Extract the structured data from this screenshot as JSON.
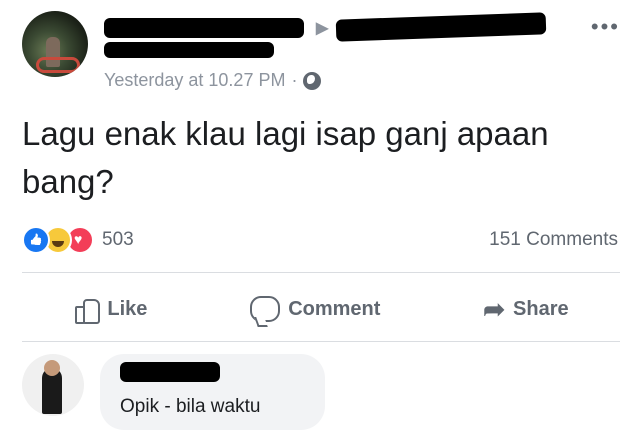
{
  "post": {
    "author_redacted": "",
    "timestamp": "Yesterday at 10.27 PM",
    "separator": "·",
    "privacy_icon": "globe-icon",
    "more_icon": "more-options-icon",
    "text": "Lagu enak klau lagi isap ganj apaan bang?"
  },
  "stats": {
    "reaction_icons": [
      "like-reaction-icon",
      "haha-reaction-icon",
      "love-reaction-icon"
    ],
    "reaction_count": "503",
    "comments_count": "151 Comments"
  },
  "actions": {
    "like_label": "Like",
    "comment_label": "Comment",
    "share_label": "Share"
  },
  "comment": {
    "author_redacted": "",
    "text": "Opik - bila waktu"
  },
  "colors": {
    "link": "#365899",
    "secondary_text": "#606770",
    "like_blue": "#1877f2",
    "haha_yellow": "#f7c93b",
    "love_red": "#f33e58",
    "bubble": "#f2f3f5"
  }
}
